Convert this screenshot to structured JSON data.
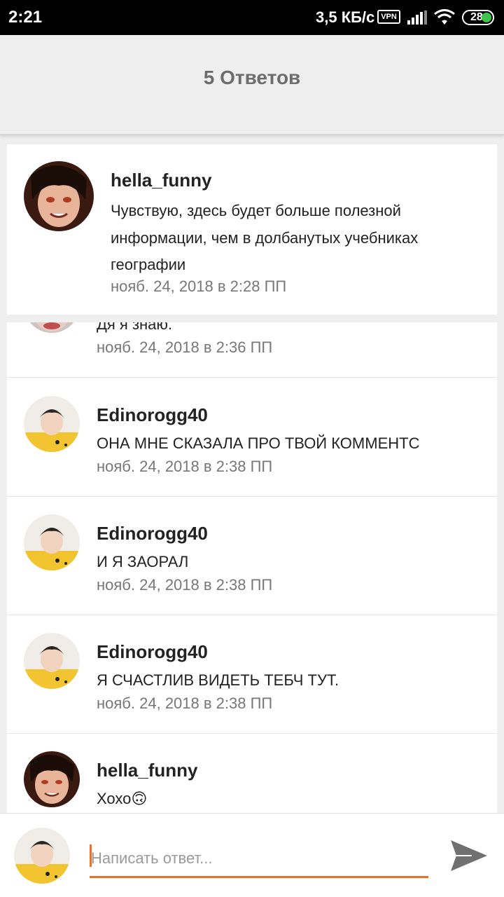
{
  "status_bar": {
    "time": "2:21",
    "speed": "3,5 КБ/с",
    "vpn": "VPN",
    "battery": "28",
    "icons": [
      "vpn-icon",
      "signal-icon",
      "wifi-icon",
      "battery-icon"
    ]
  },
  "header": {
    "title": "5 Ответов"
  },
  "parent_comment": {
    "author": "hella_funny",
    "text": "Чувствую, здесь будет больше полезной информации, чем в долбанутых учебниках географии",
    "date": "нояб. 24, 2018 в 2:28 ПП"
  },
  "replies": [
    {
      "author": "",
      "text": "Дя я знаю.",
      "date": "нояб. 24, 2018 в 2:36 ПП"
    },
    {
      "author": "Edinorogg40",
      "text": "ОНА МНЕ СКАЗАЛА ПРО ТВОЙ КОММЕНТС",
      "date": "нояб. 24, 2018 в 2:38 ПП"
    },
    {
      "author": "Edinorogg40",
      "text": "И Я ЗАОРАЛ",
      "date": "нояб. 24, 2018 в 2:38 ПП"
    },
    {
      "author": "Edinorogg40",
      "text": "Я СЧАСТЛИВ ВИДЕТЬ ТЕБЧ ТУТ.",
      "date": "нояб. 24, 2018 в 2:38 ПП"
    },
    {
      "author": "hella_funny",
      "text": "Хохо🙃",
      "date": ""
    }
  ],
  "composer": {
    "placeholder": "Написать ответ...",
    "value": ""
  },
  "colors": {
    "accent": "#e8722c",
    "header_bg": "#efefef",
    "title": "#6d6d6d",
    "date": "#777777"
  }
}
